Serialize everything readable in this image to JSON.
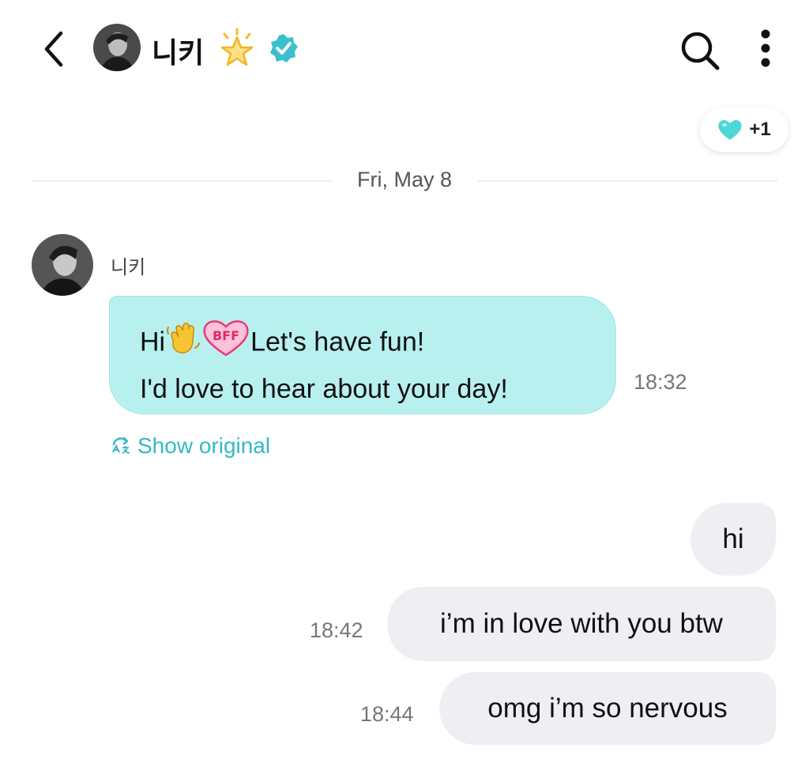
{
  "header": {
    "name": "니키",
    "accent": "#3cbfcf"
  },
  "reactions": {
    "count": "+1",
    "color": "#4fd6d6"
  },
  "date_divider": "Fri, May 8",
  "incoming": {
    "sender": "니키",
    "line1_a": "Hi",
    "line1_b": "Let's have fun!",
    "line2": "I'd love to hear about your day!",
    "badge": "BFF",
    "time": "18:32",
    "show_original": "Show original",
    "bubble_color": "#b8f0f0"
  },
  "outgoing": [
    {
      "text": "hi",
      "time": ""
    },
    {
      "text": "i’m in love with you btw",
      "time": "18:42"
    },
    {
      "text": "omg i’m so nervous",
      "time": "18:44"
    }
  ],
  "icons": [
    "chevron-left-icon",
    "star-icon",
    "verified-icon",
    "search-icon",
    "more-vertical-icon",
    "heart-icon",
    "wave-hand-icon",
    "bff-heart-icon",
    "translate-icon"
  ]
}
